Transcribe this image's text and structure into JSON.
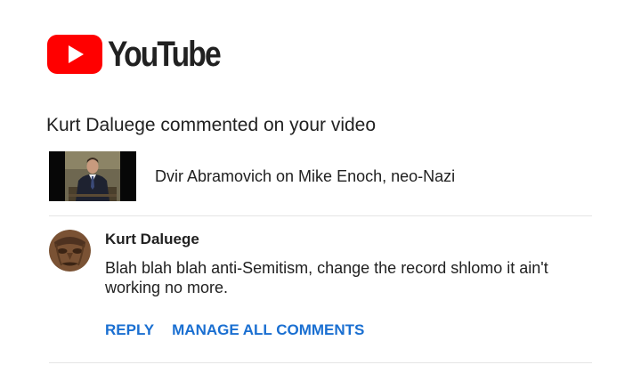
{
  "header": {
    "logo_text": "YouTube",
    "brand_color": "#ff0000"
  },
  "notification": {
    "headline": "Kurt Daluege commented on your video",
    "video": {
      "title": "Dvir Abramovich on Mike Enoch, neo-Nazi"
    },
    "comment": {
      "author": "Kurt Daluege",
      "text": "Blah blah blah anti-Semitism, change the record shlomo it ain't working no more."
    },
    "actions": {
      "reply_label": "REPLY",
      "manage_label": "MANAGE ALL COMMENTS",
      "link_color": "#1a6fd1"
    }
  }
}
